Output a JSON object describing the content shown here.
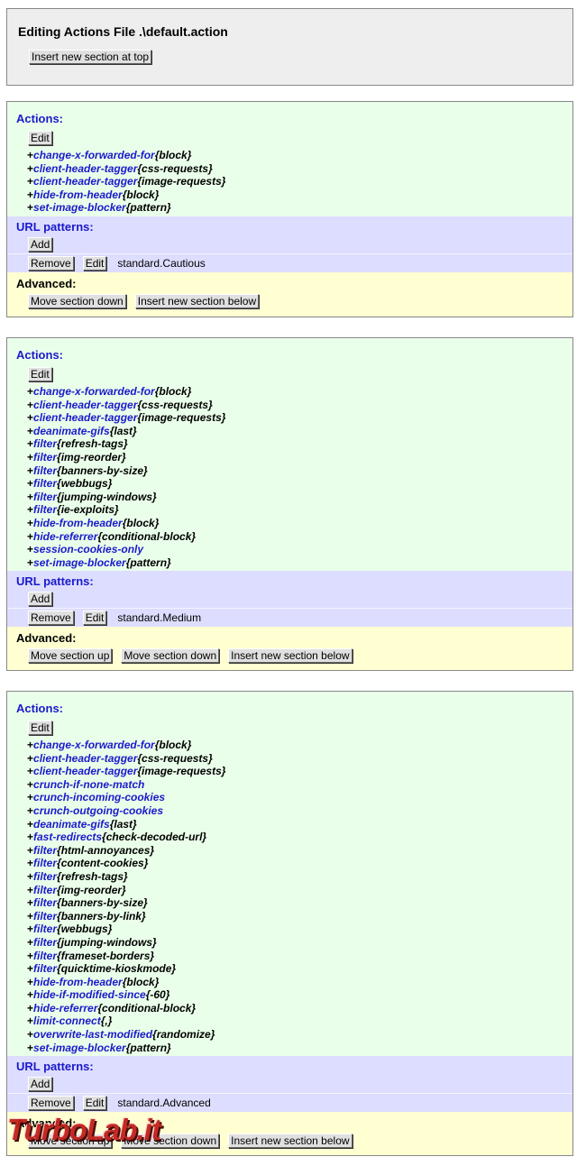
{
  "header": {
    "title": "Editing Actions File .\\default.action",
    "insert_top_label": "Insert new section at top"
  },
  "labels": {
    "actions": "Actions:",
    "url_patterns": "URL patterns:",
    "advanced": "Advanced:",
    "edit": "Edit",
    "add": "Add",
    "remove": "Remove",
    "move_up": "Move section up",
    "move_down": "Move section down",
    "insert_below": "Insert new section below"
  },
  "sections": [
    {
      "actions": [
        {
          "name": "change-x-forwarded-for",
          "param": "{block}"
        },
        {
          "name": "client-header-tagger",
          "param": "{css-requests}"
        },
        {
          "name": "client-header-tagger",
          "param": "{image-requests}"
        },
        {
          "name": "hide-from-header",
          "param": "{block}"
        },
        {
          "name": "set-image-blocker",
          "param": "{pattern}"
        }
      ],
      "pattern": "standard.Cautious"
    },
    {
      "actions": [
        {
          "name": "change-x-forwarded-for",
          "param": "{block}"
        },
        {
          "name": "client-header-tagger",
          "param": "{css-requests}"
        },
        {
          "name": "client-header-tagger",
          "param": "{image-requests}"
        },
        {
          "name": "deanimate-gifs",
          "param": "{last}"
        },
        {
          "name": "filter",
          "param": "{refresh-tags}"
        },
        {
          "name": "filter",
          "param": "{img-reorder}"
        },
        {
          "name": "filter",
          "param": "{banners-by-size}"
        },
        {
          "name": "filter",
          "param": "{webbugs}"
        },
        {
          "name": "filter",
          "param": "{jumping-windows}"
        },
        {
          "name": "filter",
          "param": "{ie-exploits}"
        },
        {
          "name": "hide-from-header",
          "param": "{block}"
        },
        {
          "name": "hide-referrer",
          "param": "{conditional-block}"
        },
        {
          "name": "session-cookies-only",
          "param": ""
        },
        {
          "name": "set-image-blocker",
          "param": "{pattern}"
        }
      ],
      "pattern": "standard.Medium"
    },
    {
      "actions": [
        {
          "name": "change-x-forwarded-for",
          "param": "{block}"
        },
        {
          "name": "client-header-tagger",
          "param": "{css-requests}"
        },
        {
          "name": "client-header-tagger",
          "param": "{image-requests}"
        },
        {
          "name": "crunch-if-none-match",
          "param": ""
        },
        {
          "name": "crunch-incoming-cookies",
          "param": ""
        },
        {
          "name": "crunch-outgoing-cookies",
          "param": ""
        },
        {
          "name": "deanimate-gifs",
          "param": "{last}"
        },
        {
          "name": "fast-redirects",
          "param": "{check-decoded-url}"
        },
        {
          "name": "filter",
          "param": "{html-annoyances}"
        },
        {
          "name": "filter",
          "param": "{content-cookies}"
        },
        {
          "name": "filter",
          "param": "{refresh-tags}"
        },
        {
          "name": "filter",
          "param": "{img-reorder}"
        },
        {
          "name": "filter",
          "param": "{banners-by-size}"
        },
        {
          "name": "filter",
          "param": "{banners-by-link}"
        },
        {
          "name": "filter",
          "param": "{webbugs}"
        },
        {
          "name": "filter",
          "param": "{jumping-windows}"
        },
        {
          "name": "filter",
          "param": "{frameset-borders}"
        },
        {
          "name": "filter",
          "param": "{quicktime-kioskmode}"
        },
        {
          "name": "hide-from-header",
          "param": "{block}"
        },
        {
          "name": "hide-if-modified-since",
          "param": "{-60}"
        },
        {
          "name": "hide-referrer",
          "param": "{conditional-block}"
        },
        {
          "name": "limit-connect",
          "param": "{,}"
        },
        {
          "name": "overwrite-last-modified",
          "param": "{randomize}"
        },
        {
          "name": "set-image-blocker",
          "param": "{pattern}"
        }
      ],
      "pattern": "standard.Advanced"
    }
  ],
  "watermark": "TurboLab.it",
  "colors": {
    "actions_bg": "#eaffea",
    "url_bg": "#ddddff",
    "advanced_bg": "#ffffd2",
    "heading_blue": "#1a1acc",
    "watermark_red": "#c0201a"
  }
}
